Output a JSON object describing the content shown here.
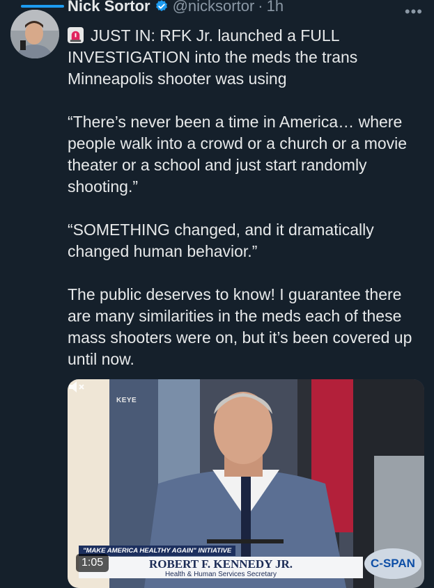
{
  "author": {
    "name": "Nick Sortor",
    "handle": "@nicksortor",
    "separator": "·",
    "time": "1h",
    "verified": true
  },
  "more_label": "•••",
  "tweet": {
    "line1": "JUST IN: RFK Jr. launched a FULL INVESTIGATION into the meds the trans Minneapolis shooter was using",
    "para2": "“There’s never been a time in America… where people walk into a crowd or a church or a movie theater or a school and just start randomly shooting.”",
    "para3": "“SOMETHING changed, and it dramatically changed human behavior.”",
    "para4": "The public deserves to know! I guarantee there are many similarities in the meds each of these mass shooters were on, but it’s been covered up until now."
  },
  "video": {
    "station_bug": "KEYE",
    "chyron_top": "\"MAKE AMERICA HEALTHY AGAIN\" INITIATIVE",
    "chyron_name": "ROBERT F. KENNEDY JR.",
    "chyron_title": "Health & Human Services Secretary",
    "network": "C-SPAN",
    "duration": "1:05"
  },
  "colors": {
    "background": "#15202b",
    "accent": "#1d9bf0",
    "secondary_text": "#8b98a5"
  },
  "icons": [
    "verified-badge-icon",
    "siren-icon",
    "more-icon",
    "mute-icon"
  ]
}
